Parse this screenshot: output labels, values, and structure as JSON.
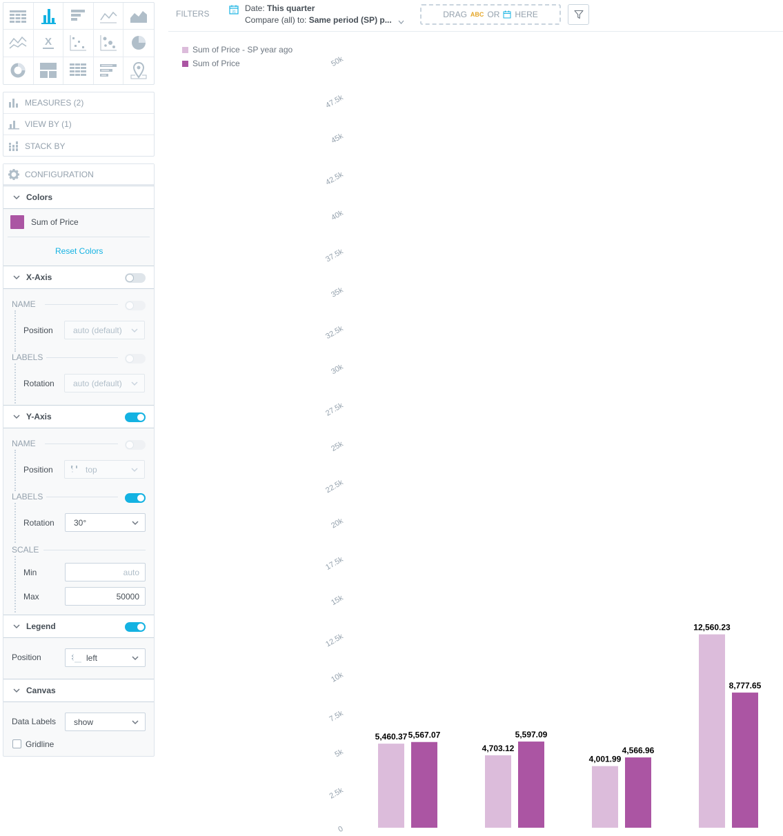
{
  "config": {
    "buckets": {
      "measures": "MEASURES (2)",
      "view_by": "VIEW BY (1)",
      "stack_by": "STACK BY"
    },
    "header": "CONFIGURATION",
    "colors": {
      "title": "Colors",
      "item_label": "Sum of Price",
      "item_color": "#ab55a3",
      "reset_label": "Reset Colors"
    },
    "x_axis": {
      "title": "X-Axis",
      "enabled": false,
      "name_label": "NAME",
      "position_label": "Position",
      "position_value": "auto (default)",
      "labels_label": "LABELS",
      "rotation_label": "Rotation",
      "rotation_value": "auto (default)"
    },
    "y_axis": {
      "title": "Y-Axis",
      "enabled": true,
      "name_label": "NAME",
      "position_label": "Position",
      "position_value": "top",
      "labels_label": "LABELS",
      "rotation_label": "Rotation",
      "rotation_value": "30°",
      "scale_label": "SCALE",
      "min_label": "Min",
      "min_placeholder": "auto",
      "max_label": "Max",
      "max_value": "50000"
    },
    "legend": {
      "title": "Legend",
      "enabled": true,
      "position_label": "Position",
      "position_value": "left"
    },
    "canvas": {
      "title": "Canvas",
      "data_labels_label": "Data Labels",
      "data_labels_value": "show",
      "gridline_label": "Gridline",
      "gridline_checked": false
    }
  },
  "filter_bar": {
    "filters_label": "FILTERS",
    "date_prefix": "Date: ",
    "date_value": "This quarter",
    "compare_prefix": "Compare (all) to: ",
    "compare_value": "Same period (SP) p...",
    "drop_zone": {
      "drag": "DRAG",
      "abc": "ABC",
      "or": "OR",
      "here": "HERE"
    }
  },
  "legend": {
    "items": [
      {
        "label": "Sum of Price - SP year ago",
        "color": "#dcbcdb"
      },
      {
        "label": "Sum of Price",
        "color": "#ab55a3"
      }
    ]
  },
  "chart_data": {
    "type": "bar",
    "categories": [
      "",
      "",
      "",
      ""
    ],
    "series": [
      {
        "name": "Sum of Price - SP year ago",
        "color": "#dcbcdb",
        "values": [
          5460.37,
          4703.12,
          4001.99,
          12560.23
        ],
        "labels": [
          "5,460.37",
          "4,703.12",
          "4,001.99",
          "12,560.23"
        ]
      },
      {
        "name": "Sum of Price",
        "color": "#ab55a3",
        "values": [
          5567.07,
          5597.09,
          4566.96,
          8777.65
        ],
        "labels": [
          "5,567.07",
          "5,597.09",
          "4,566.96",
          "8,777.65"
        ]
      }
    ],
    "ylim": [
      0,
      50000
    ],
    "yticks": [
      0,
      2500,
      5000,
      7500,
      10000,
      12500,
      15000,
      17500,
      20000,
      22500,
      25000,
      27500,
      30000,
      32500,
      35000,
      37500,
      40000,
      42500,
      45000,
      47500,
      50000
    ],
    "ytick_labels": [
      "0",
      "2.5k",
      "5k",
      "7.5k",
      "10k",
      "12.5k",
      "15k",
      "17.5k",
      "20k",
      "22.5k",
      "25k",
      "27.5k",
      "30k",
      "32.5k",
      "35k",
      "37.5k",
      "40k",
      "42.5k",
      "45k",
      "47.5k",
      "50k"
    ],
    "ylabel_rotation_deg": -30,
    "grid": false,
    "data_labels": true,
    "legend_position": "top-left"
  }
}
